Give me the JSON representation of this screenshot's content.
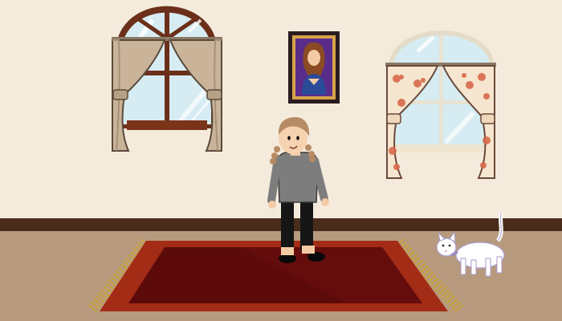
{
  "scene": {
    "room": "living-room",
    "characters": [
      {
        "id": "girl",
        "icon": "girl-character-icon",
        "hair": "braided-pigtails",
        "shirt_color": "#7d7d7d",
        "pants_color": "#161616"
      },
      {
        "id": "cat",
        "icon": "white-cat-icon",
        "fur_color": "#ffffff",
        "collar_color": "#9a86c9"
      }
    ],
    "colors": {
      "wall": "#f2e8d6",
      "baseboard": "#4a2c1b",
      "floor": "#b79a7e",
      "rug_outer": "#a32c16",
      "rug_inner": "#5c0a0a",
      "rug_fringe": "#c9a33c",
      "window_frame": "#6b2f1a",
      "curtain_left_window": "#c9b49a",
      "curtain_right_window": "#f6e5cf",
      "curtain_flower": "#d86a4b",
      "painting_frame": "#2b1b20",
      "painting_background": "#5a2c8a"
    }
  }
}
